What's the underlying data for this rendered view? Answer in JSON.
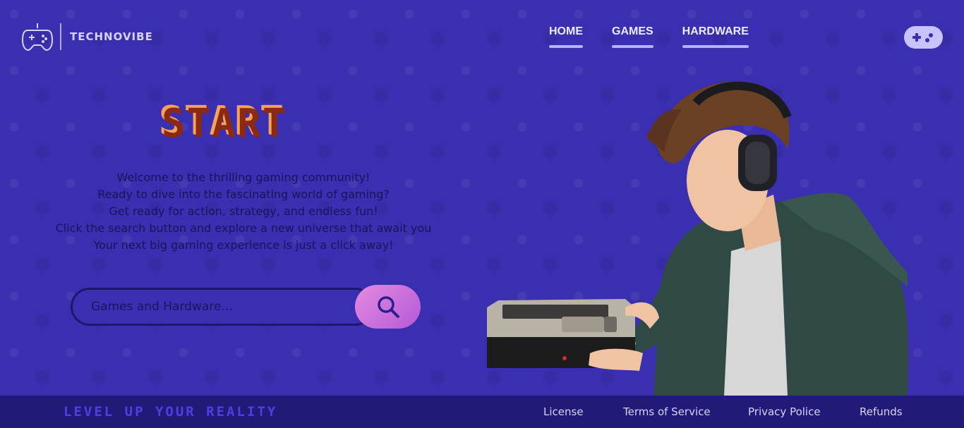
{
  "header": {
    "brand": "TECHNOVIBE",
    "logo_icon": "gamepad-icon",
    "nav": [
      {
        "label": "HOME"
      },
      {
        "label": "GAMES"
      },
      {
        "label": "HARDWARE"
      }
    ],
    "action_icon": "gamepad-icon"
  },
  "hero": {
    "title": "START",
    "intro_lines": [
      "Welcome to the thrilling gaming community!",
      "Ready to dive into the fascinating world of gaming?",
      "Get ready for action, strategy, and endless fun!",
      "Click the search button and explore a new universe that await you",
      "Your next big gaming experience is just a click away!"
    ],
    "search": {
      "placeholder": "Games and Hardware...",
      "button_icon": "search-icon"
    }
  },
  "footer": {
    "tagline": "LEVEL UP YOUR REALITY",
    "links": [
      {
        "label": "License"
      },
      {
        "label": "Terms of Service"
      },
      {
        "label": "Privacy Police"
      },
      {
        "label": "Refunds"
      }
    ]
  },
  "colors": {
    "background": "#3a2fb0",
    "footer": "#221a78",
    "accent": "#c8c3ff",
    "search_button": "#d07ae0",
    "title": "#e8632a"
  }
}
